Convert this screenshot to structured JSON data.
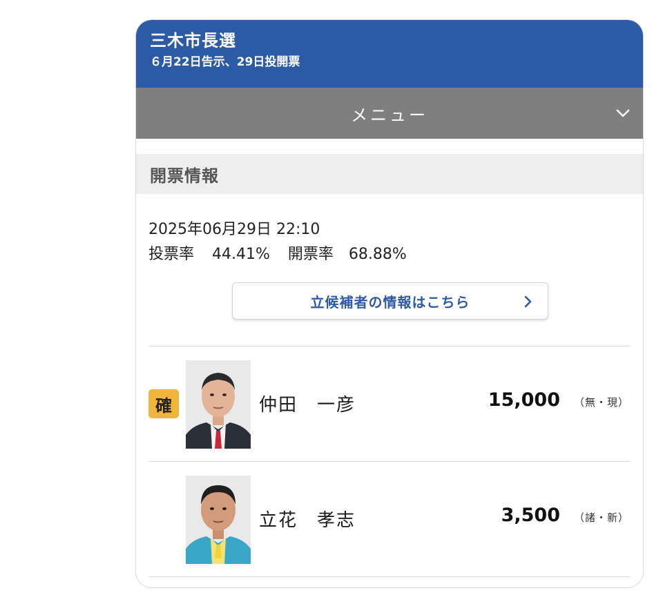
{
  "header": {
    "title": "三木市長選",
    "subtitle": "６月22日告示、29日投開票"
  },
  "menu": {
    "label": "メニュー",
    "toggle_icon": "chevron-down-icon"
  },
  "section": {
    "title": "開票情報"
  },
  "status": {
    "datetime": "2025年06月29日 22:10",
    "turnout_label": "投票率",
    "turnout_value": "44.41%",
    "counted_label": "開票率",
    "counted_value": "68.88%"
  },
  "candidate_link": {
    "label": "立候補者の情報はこちら",
    "icon": "chevron-right-icon"
  },
  "candidates": [
    {
      "elected_badge": "確",
      "name": "仲田　一彦",
      "votes": "15,000",
      "party": "（無・現）",
      "jacket_color": "#2b2f3a",
      "tie_color": "#c8283a",
      "backdrop_color": "#e9e9ea"
    },
    {
      "elected_badge": "",
      "name": "立花　孝志",
      "votes": "3,500",
      "party": "（諸・新）",
      "jacket_color": "#3aa6c8",
      "tie_color": "#f2d43a",
      "backdrop_color": "#e9e9ea"
    }
  ],
  "colors": {
    "header_bg": "#2d5aa4",
    "menu_bg": "#7f7f7f",
    "badge_bg": "#f1b43c",
    "link_text": "#2d5aa4"
  }
}
